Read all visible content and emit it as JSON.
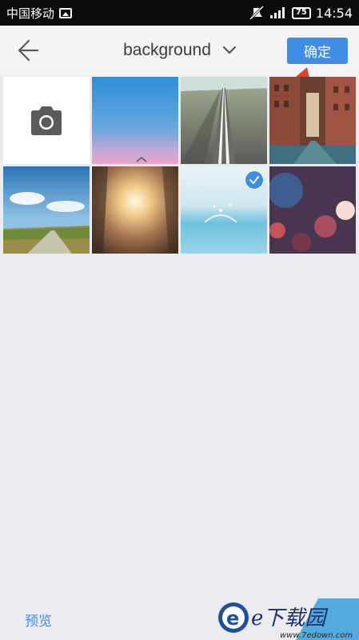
{
  "status_bar": {
    "carrier": "中国移动",
    "battery": "75",
    "time": "14:54"
  },
  "header": {
    "back_icon": "arrow-left-icon",
    "album": "background",
    "dropdown_icon": "chevron-down-icon",
    "confirm_label": "确定"
  },
  "grid": {
    "camera_icon": "camera-icon",
    "photos": [
      {
        "subject": "blue-sky-gradient",
        "selected": false
      },
      {
        "subject": "road-center-line",
        "selected": false
      },
      {
        "subject": "city-street",
        "selected": false
      },
      {
        "subject": "countryside-road",
        "selected": false
      },
      {
        "subject": "sunlight-through-trees",
        "selected": false
      },
      {
        "subject": "water-splash",
        "selected": true
      },
      {
        "subject": "bokeh-lights",
        "selected": false
      }
    ]
  },
  "footer": {
    "preview_label": "预览"
  },
  "watermark": {
    "brand_text": "e下载园",
    "url": "www.7edown.com"
  },
  "colors": {
    "accent": "#3f8de6",
    "annotation_arrow": "#e8402a"
  }
}
